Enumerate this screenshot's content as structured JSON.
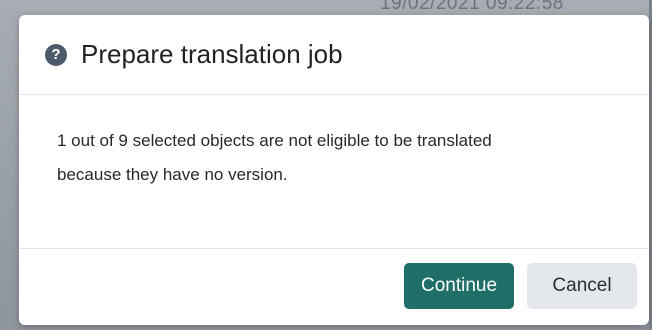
{
  "background": {
    "timestamp": "19/02/2021 09:22:58"
  },
  "dialog": {
    "title": "Prepare translation job",
    "help_icon": "question-circle-icon",
    "message_line1": "1 out of 9 selected objects are not eligible to be translated",
    "message_line2": "because they have no version.",
    "buttons": {
      "continue_label": "Continue",
      "cancel_label": "Cancel"
    }
  },
  "colors": {
    "primary": "#1f6f68",
    "secondary": "#e4e8ed",
    "icon": "#4d5a6b"
  }
}
